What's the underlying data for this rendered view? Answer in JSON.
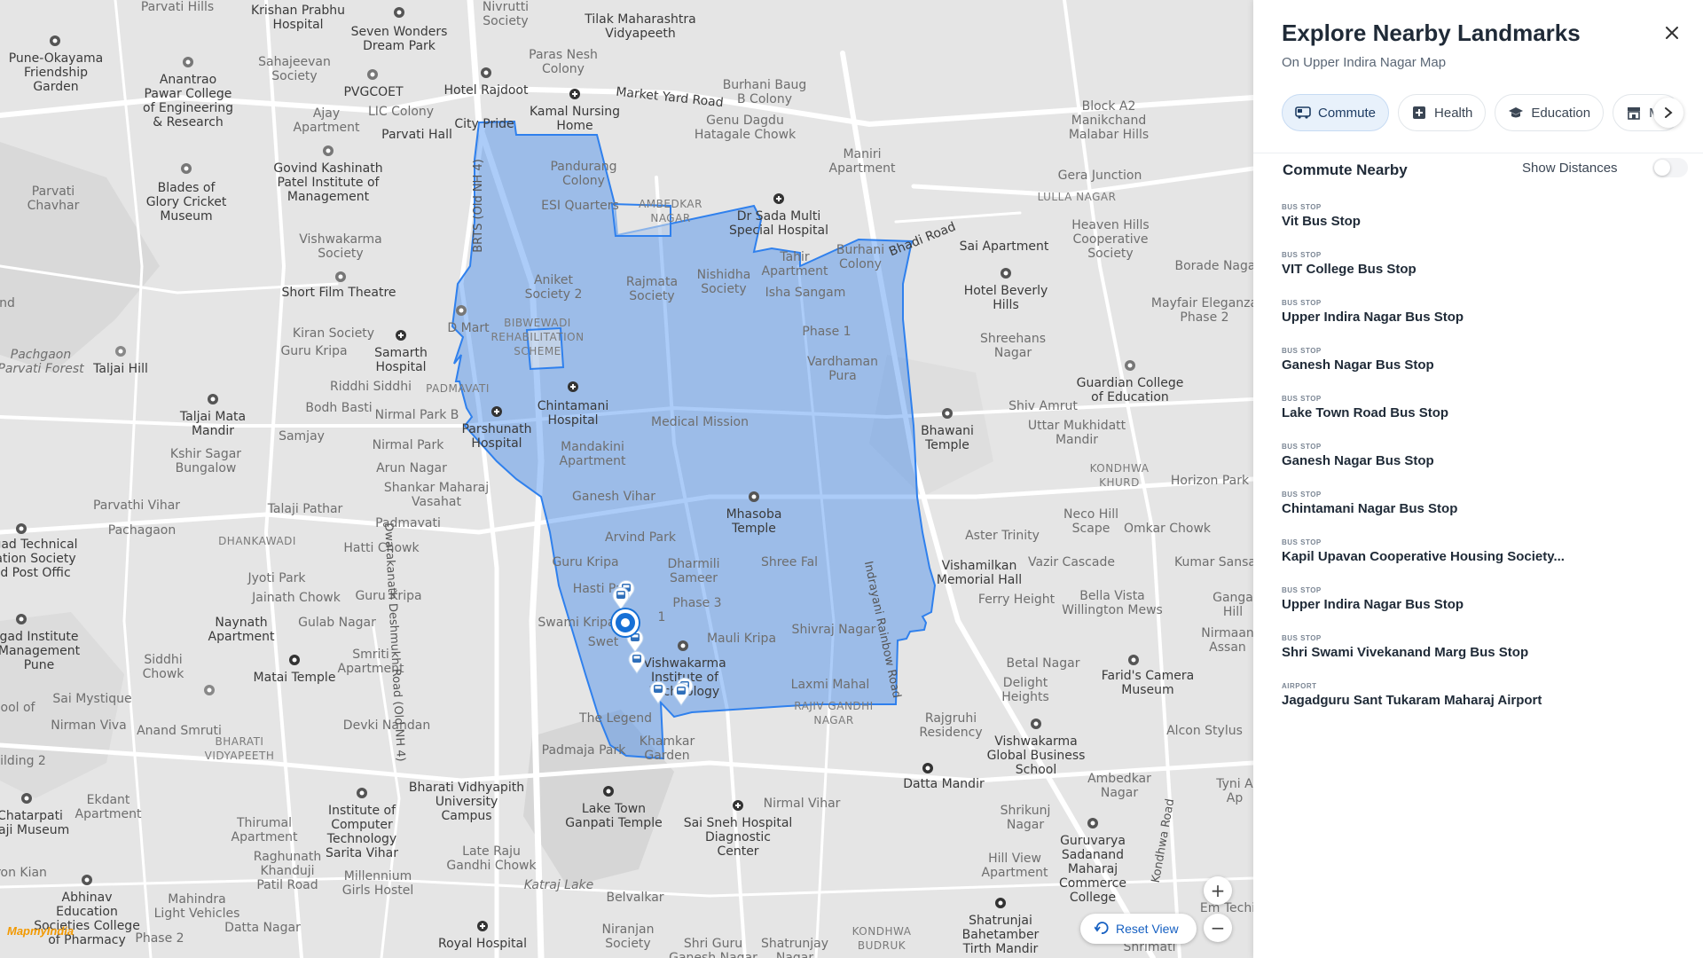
{
  "panel": {
    "title": "Explore Nearby Landmarks",
    "subtitle": "On Upper Indira Nagar Map",
    "tabs": [
      {
        "label": "Commute",
        "icon": "bus-icon",
        "active": true
      },
      {
        "label": "Health",
        "icon": "health-plus-icon",
        "active": false
      },
      {
        "label": "Education",
        "icon": "graduation-cap-icon",
        "active": false
      },
      {
        "label": "Ma",
        "icon": "store-icon",
        "active": false
      }
    ],
    "section_title": "Commute Nearby",
    "show_distances_label": "Show Distances",
    "show_distances_on": false,
    "items": [
      {
        "type": "BUS STOP",
        "name": "Vit Bus Stop"
      },
      {
        "type": "BUS STOP",
        "name": "VIT College Bus Stop"
      },
      {
        "type": "BUS STOP",
        "name": "Upper Indira Nagar Bus Stop"
      },
      {
        "type": "BUS STOP",
        "name": "Ganesh Nagar Bus Stop"
      },
      {
        "type": "BUS STOP",
        "name": "Lake Town Road Bus Stop"
      },
      {
        "type": "BUS STOP",
        "name": "Ganesh Nagar Bus Stop"
      },
      {
        "type": "BUS STOP",
        "name": "Chintamani Nagar Bus Stop"
      },
      {
        "type": "BUS STOP",
        "name": "Kapil Upavan Cooperative Housing Society..."
      },
      {
        "type": "BUS STOP",
        "name": "Upper Indira Nagar Bus Stop"
      },
      {
        "type": "BUS STOP",
        "name": "Shri Swami Vivekanand Marg Bus Stop"
      },
      {
        "type": "AIRPORT",
        "name": "Jagadguru Sant Tukaram Maharaj Airport"
      }
    ]
  },
  "map": {
    "reset_label": "Reset View",
    "zoom_in": "+",
    "zoom_out": "−",
    "brand": "MapmyIndia",
    "highlight_color": "#2f80ed",
    "labels": {
      "parvati_hills": "Parvati Hills",
      "krishan_prabhu": "Krishan Prabhu\nHospital",
      "seven_wonders": "Seven Wonders\nDream Park",
      "nivrutti": "Nivrutti\nSociety",
      "tilak": "Tilak Maharashtra\nVidyapeeth",
      "pune_okayama": "Pune-Okayama\nFriendship\nGarden",
      "anantrao": "Anantrao\nPawar College\nof Engineering\n& Research",
      "sahajeevan": "Sahajeevan\nSociety",
      "pvgcoet": "PVGCOET",
      "hotel_rajdoot": "Hotel Rajdoot",
      "paras_nesh": "Paras Nesh\nColony",
      "market_yard": "Market Yard Road",
      "burhani_baug": "Burhani Baug\nB Colony",
      "ajay_apt": "Ajay\nApartment",
      "lic_colony": "LIC Colony",
      "kamal": "Kamal Nursing\nHome",
      "genu": "Genu Dagdu\nHatagale Chowk",
      "block_a2": "Block A2\nManikchand\nMalabar Hills",
      "parvati_hall": "Parvati Hall",
      "city_pride": "City Pride",
      "pandurang": "Pandurang\nColony",
      "maniri": "Maniri\nApartment",
      "govind": "Govind Kashinath\nPatel Institute of\nManagement",
      "parvati_chavhar": "Parvati\nChavhar",
      "blades": "Blades of\nGlory Cricket\nMuseum",
      "esi": "ESI Quarters",
      "ambedkar": "AMBEDKAR\nNAGAR",
      "dr_sada": "Dr Sada Multi\nSpecial Hospital",
      "gera": "Gera Junction",
      "lulla": "LULLA NAGAR",
      "bhadi_road": "Bhadi Road",
      "heaven_hills": "Heaven Hills\nCooperative\nSociety",
      "borade": "Borade Naga",
      "vishwakarma_soc": "Vishwakarma\nSociety",
      "brts": "BRTS (Old NH 4)",
      "aniket": "Aniket\nSociety 2",
      "rajmata": "Rajmata\nSociety",
      "nishidha": "Nishidha\nSociety",
      "tahir": "Tahir\nApartment",
      "burhani_colony": "Burhani\nColony",
      "sai_apt": "Sai Apartment",
      "short_film": "Short Film Theatre",
      "isha": "Isha Sangam",
      "hotel_beverly": "Hotel Beverly\nHills",
      "mayfair": "Mayfair Eleganza\nPhase 2",
      "kiran": "Kiran Society",
      "d_mart": "D Mart",
      "bibwewadi": "BIBWEWADI\nREHABILITATION\nSCHEME",
      "phase1": "Phase 1",
      "shreehans": "Shreehans\nNagar",
      "guru_kripa1": "Guru Kripa",
      "samarth": "Samarth\nHospital",
      "vardhaman": "Vardhaman\nPura",
      "guardian": "Guardian College\nof Education",
      "pachgaon": "Pachgaon\nParvati Forest",
      "taljai_hill": "Taljai Hill",
      "riddhi": "Riddhi Siddhi",
      "padmavati1": "PADMAVATI",
      "chintamani": "Chintamani\nHospital",
      "shiv_amrut": "Shiv Amrut",
      "uttar": "Uttar Mukhidatt\nMandir",
      "bodh": "Bodh Basti",
      "nirmal_park": "Nirmal Park B",
      "medical": "Medical Mission",
      "bhawani": "Bhawani\nTemple",
      "taljai_mata": "Taljai Mata\nMandir",
      "parshunath": "Parshunath\nHospital",
      "mandakini": "Mandakini\nApartment",
      "kondhwa_khurd": "KONDHWA\nKHURD",
      "samjay": "Samjay",
      "nirmal_park2": "Nirmal Park",
      "kshir": "Kshir Sagar\nBungalow",
      "arun": "Arun Nagar",
      "horizon": "Horizon Park",
      "shankar": "Shankar Maharaj\nVasahat",
      "ganesh_vihar": "Ganesh Vihar",
      "mhasoba": "Mhasoba\nTemple",
      "parvathi_vihar": "Parvathi Vihar",
      "talaji_pathar": "Talaji Pathar",
      "neco": "Neco Hill\nScape",
      "padmavati2": "Padmavati",
      "aster": "Aster Trinity",
      "omkar": "Omkar Chowk",
      "pachagaon": "Pachagaon",
      "dhankawadi": "DHANKAWADI",
      "aravind": "Arvind Park",
      "gad_tech": "gad Technical\nation Society\nd Post Offic",
      "hatti": "Hatti Chowk",
      "guru_kripa2": "Guru Kripa",
      "dharmili": "Dharmili\nSameer",
      "shree_fal": "Shree Fal",
      "vishamilkan": "Vishamilkan\nMemorial Hall",
      "vazir": "Vazir Cascade",
      "kumar_sansar": "Kumar Sansa",
      "jyoti": "Jyoti Park",
      "hasti": "Hasti Pa",
      "phase3": "Phase 3",
      "indrayani": "Indrayani Rainbow Road",
      "ferry": "Ferry Height",
      "bella": "Bella Vista\nWillington Mews",
      "ganga": "Ganga\nHill",
      "jainath": "Jainath Chowk",
      "guru_kripa3": "Guru Kripa",
      "swami_kripa": "Swami Kripa",
      "phase1b": "1",
      "shivraj": "Shivraj Nagar",
      "naynath": "Naynath\nApartment",
      "gulab": "Gulab Nagar",
      "swet": "Swet",
      "mauli": "Mauli Kripa",
      "nirmaan": "Nirmaan\nAssan",
      "gad_inst": "gad Institute\nManagement\nPune",
      "siddhi_chowk": "Siddhi\nChowk",
      "matai": "Matai Temple",
      "smriti": "Smriti\nApartment",
      "vishwakarma_inst": "Vishwakarma\nInstitute of\nTechnology",
      "betal": "Betal Nagar",
      "farid": "Farid's Camera\nMuseum",
      "sai_mystique": "Sai Mystique",
      "laxmi": "Laxmi Mahal",
      "delight": "Delight\nHeights",
      "ool_of": "ool of",
      "nirman_viva": "Nirman Viva",
      "anand_smruti": "Anand Smruti",
      "devki": "Devki Nandan",
      "legend": "The Legend",
      "rajiv": "RAJIV GANDHI\nNAGAR",
      "rajgruhi": "Rajgruhi\nResidency",
      "vishwakarma_global": "Vishwakarma\nGlobal Business\nSchool",
      "alcon": "Alcon Stylus",
      "ilding": "ilding 2",
      "bharati_vid": "BHARATI\nVIDYAPEETH",
      "padmaja": "Padmaja Park",
      "khamkar": "Khamkar\nGarden",
      "bharati_univ": "Bharati Vidhyapith\nUniversity\nCampus",
      "datta": "Datta Mandir",
      "ambedkar_n": "Ambedkar\nNagar",
      "tyni": "Tyni A\nAp",
      "chatarpati": "Chatarpati\nvaji Museum",
      "ekdant": "Ekdant\nApartment",
      "thirumal": "Thirumal\nApartment",
      "ioct": "Institute of\nComputer\nTechnology\nSarita Vihar",
      "lake_town": "Lake Town\nGanpati Temple",
      "sai_sneh": "Sai Sneh Hospital\nDiagnostic\nCenter",
      "nirmal_vihar": "Nirmal Vihar",
      "shrikunj": "Shrikunj\nNagar",
      "guruvarya": "Guruvarya\nSadanand\nMaharaj\nCommerce\nCollege",
      "raghunath": "Raghunath\nKhanduji\nPatil Road",
      "late_raju": "Late Raju\nGandhi Chowk",
      "hill_view": "Hill View\nApartment",
      "kondhwa_road": "Kondhwa Road",
      "ron_kian": "ron Kian",
      "abhinav": "Abhinav\nEducation\nSocieties College\nof Pharmacy",
      "mahindra": "Mahindra\nLight Vehicles",
      "millennium": "Millennium\nGirls Hostel",
      "katraj": "Katraj Lake",
      "belvalkar": "Belvalkar",
      "emtech": "Em Techi",
      "phase2": "Phase 2",
      "datta_nagar": "Datta Nagar",
      "royal": "Royal Hospital",
      "niranjan": "Niranjan\nSociety",
      "shri_guru": "Shri Guru\nGanesh Nagar",
      "shatrunjay": "Shatrunjay\nNagar",
      "kondhwa_budruk": "KONDHWA\nBUDRUK",
      "shatrunjai_temple": "Shatrunjai\nBahetamber\nTirth Mandir",
      "shrimati": "Shrimati",
      "dwarkanath": "Dwarakanath Deshmukh Road (Old NH 4)",
      "nd": "nd"
    }
  }
}
